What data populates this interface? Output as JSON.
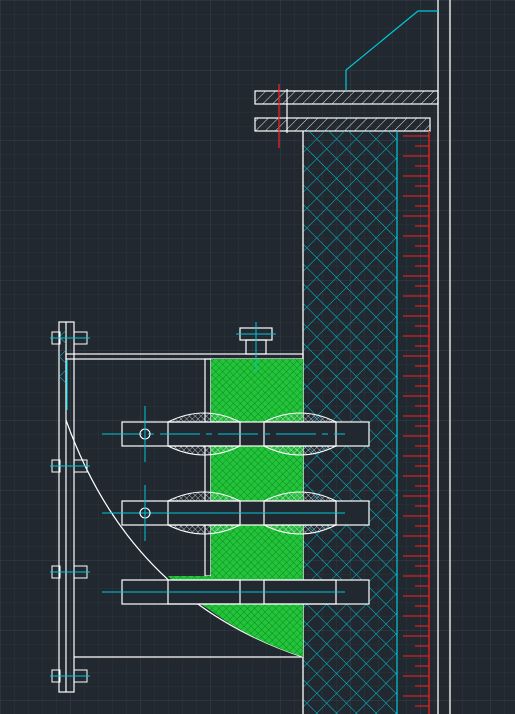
{
  "viewport": {
    "name": "CAD model space",
    "background": "#212830",
    "grid_minor_color": "#2a333d",
    "grid_major_color": "#38424e"
  },
  "colors": {
    "outline": "#ffffff",
    "cyan": "#00c8d7",
    "red": "#ff2020",
    "green": "#22c43a",
    "hatch_white": "#dfe4e8"
  },
  "text_labels": []
}
